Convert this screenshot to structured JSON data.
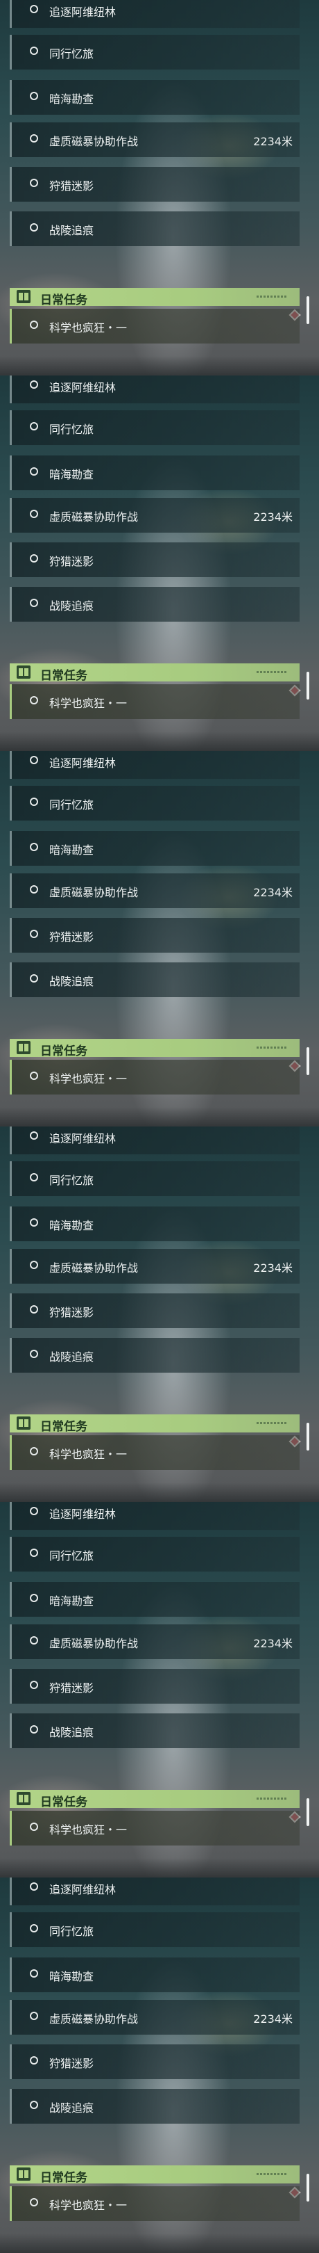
{
  "panel_count": 6,
  "tasks": [
    {
      "label": "追逐阿维纽林",
      "distance": ""
    },
    {
      "label": "同行忆旅",
      "distance": ""
    },
    {
      "label": "暗海勘查",
      "distance": ""
    },
    {
      "label": "虚质磁暴协助作战",
      "distance": "2234米"
    },
    {
      "label": "狩猎迷影",
      "distance": ""
    },
    {
      "label": "战陵追痕",
      "distance": ""
    }
  ],
  "daily": {
    "title": "日常任务",
    "icon": "book-icon",
    "tracker_icon": "diamond-marker-icon",
    "task": {
      "label": "科学也疯狂・一"
    }
  },
  "colors": {
    "daily_accent": "#b2d488",
    "tracker_marker": "#e06472",
    "text": "#eef2f2"
  }
}
